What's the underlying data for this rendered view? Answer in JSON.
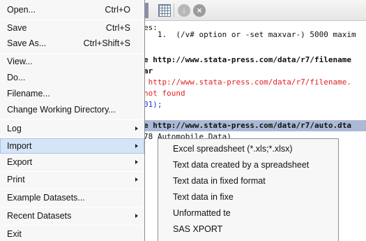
{
  "menu": {
    "items": [
      {
        "label": "Open...",
        "shortcut": "Ctrl+O",
        "submenu": false
      },
      {
        "label": "Save",
        "shortcut": "Ctrl+S",
        "submenu": false
      },
      {
        "label": "Save As...",
        "shortcut": "Ctrl+Shift+S",
        "submenu": false
      },
      {
        "label": "View...",
        "shortcut": "",
        "submenu": false
      },
      {
        "label": "Do...",
        "shortcut": "",
        "submenu": false
      },
      {
        "label": "Filename...",
        "shortcut": "",
        "submenu": false
      },
      {
        "label": "Change Working Directory...",
        "shortcut": "",
        "submenu": false
      },
      {
        "label": "Log",
        "shortcut": "",
        "submenu": true
      },
      {
        "label": "Import",
        "shortcut": "",
        "submenu": true,
        "active": true
      },
      {
        "label": "Export",
        "shortcut": "",
        "submenu": true
      },
      {
        "label": "Print",
        "shortcut": "",
        "submenu": true
      },
      {
        "label": "Example Datasets...",
        "shortcut": "",
        "submenu": false
      },
      {
        "label": "Recent Datasets",
        "shortcut": "",
        "submenu": true
      },
      {
        "label": "Exit",
        "shortcut": "",
        "submenu": false
      }
    ]
  },
  "import_submenu": {
    "items": [
      {
        "label": "Excel spreadsheet (*.xls;*.xlsx)"
      },
      {
        "label": "Text data created by a spreadsheet"
      },
      {
        "label": "Text data in fixed format"
      },
      {
        "label": "Text data in fixe"
      },
      {
        "label": "Unformatted te"
      },
      {
        "label": "SAS XPORT"
      }
    ]
  },
  "results": {
    "lines": [
      {
        "text": "es:",
        "style": "plain"
      },
      {
        "text": "   1.  (/v# option or -set maxvar-) 5000 maxim",
        "style": "plain"
      },
      {
        "text": "",
        "style": "plain"
      },
      {
        "text": "e http://www.stata-press.com/data/r7/filename",
        "style": "bold"
      },
      {
        "text": "ar",
        "style": "bold"
      },
      {
        "text": " http://www.stata-press.com/data/r7/filename.",
        "style": "red"
      },
      {
        "text": "not found",
        "style": "red"
      },
      {
        "text": "01);",
        "style": "blue"
      },
      {
        "text": "",
        "style": "plain"
      },
      {
        "text": "e http://www.stata-press.com/data/r7/auto.dta",
        "style": "bold-hl"
      },
      {
        "text": "78 Automobile Data)",
        "style": "plain"
      }
    ]
  },
  "colors": {
    "menu_bg": "#f7f7f7",
    "active_item": "#d5e4f7",
    "error_red": "#e21f1f",
    "code_blue": "#1a36c9",
    "selection": "#a9b9d6"
  },
  "icons": {
    "toolbar": [
      "data-editor-icon",
      "go-down-icon",
      "break-stop-icon"
    ],
    "submenu_arrow": "triangle-right-icon"
  }
}
